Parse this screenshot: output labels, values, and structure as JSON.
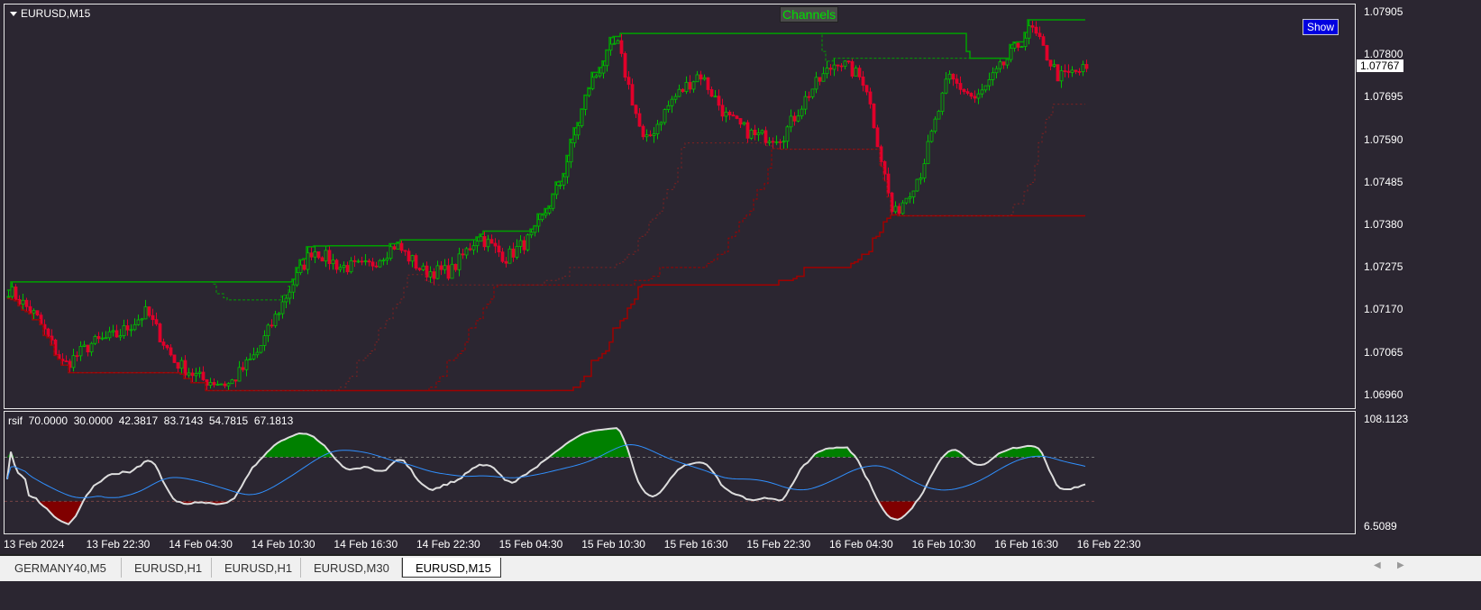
{
  "main": {
    "symbol": "EURUSD,M15",
    "indicator_label": "Channels",
    "show_button": "Show",
    "current_price": "1.07767",
    "price_labels": [
      "1.07905",
      "1.07800",
      "1.07695",
      "1.07590",
      "1.07485",
      "1.07380",
      "1.07275",
      "1.07170",
      "1.07065",
      "1.06960"
    ]
  },
  "sub": {
    "label": "rsif  70.0000  30.0000  42.3817  83.7143  54.7815  67.1813",
    "max": "108.1123",
    "min": "6.5089"
  },
  "time_labels": [
    "13 Feb 2024",
    "13 Feb 22:30",
    "14 Feb 04:30",
    "14 Feb 10:30",
    "14 Feb 16:30",
    "14 Feb 22:30",
    "15 Feb 04:30",
    "15 Feb 10:30",
    "15 Feb 16:30",
    "15 Feb 22:30",
    "16 Feb 04:30",
    "16 Feb 10:30",
    "16 Feb 16:30",
    "16 Feb 22:30"
  ],
  "tabs": [
    "GERMANY40,M5",
    "EURUSD,H1",
    "EURUSD,H1",
    "EURUSD,M30",
    "EURUSD,M15"
  ],
  "active_tab": 4,
  "colors": {
    "bull": "#00c000",
    "bear": "#e0002a",
    "channel_upper": "#00a000",
    "channel_lower": "#a00000",
    "rsi_up_fill": "#008000",
    "rsi_down_fill": "#800000"
  },
  "chart_data": {
    "type": "candlestick",
    "ylim": [
      1.0696,
      1.07905
    ],
    "approx_close_path": [
      1.07222,
      1.07155,
      1.07033,
      1.07088,
      1.07111,
      1.07166,
      1.07044,
      1.06999,
      1.06988,
      1.07066,
      1.072,
      1.07322,
      1.07278,
      1.07278,
      1.07333,
      1.07266,
      1.07266,
      1.07355,
      1.073,
      1.07355,
      1.07489,
      1.07723,
      1.07834,
      1.07578,
      1.07689,
      1.07756,
      1.07645,
      1.076,
      1.076,
      1.07711,
      1.07789,
      1.07734,
      1.074,
      1.07511,
      1.07745,
      1.07689,
      1.07778,
      1.07867,
      1.07745,
      1.07767
    ]
  }
}
